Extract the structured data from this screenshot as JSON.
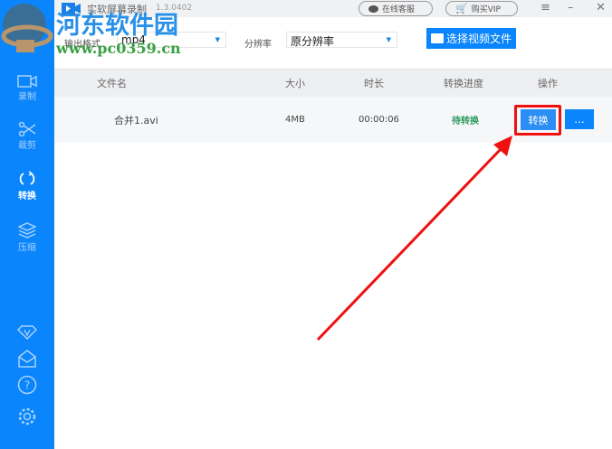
{
  "app": {
    "title": "实软屏幕录制",
    "version": "1.3.0402"
  },
  "header": {
    "online_service": "在线客服",
    "buy_vip": "购买VIP",
    "menu_icon": "menu-icon",
    "minimize_icon": "minimize-icon",
    "close_icon": "close-icon"
  },
  "sidebar": {
    "items": [
      {
        "label": "录制",
        "icon": "video-camera-icon"
      },
      {
        "label": "裁剪",
        "icon": "scissors-icon"
      },
      {
        "label": "转换",
        "icon": "convert-icon",
        "active": true
      },
      {
        "label": "压缩",
        "icon": "layers-icon"
      }
    ],
    "bottom_icons": [
      "vip-diamond-icon",
      "mail-icon",
      "help-icon",
      "settings-icon"
    ]
  },
  "toolbar": {
    "format_label": "输出格式",
    "format_value": "mp4",
    "resolution_label": "分辨率",
    "resolution_value": "原分辨率",
    "choose_file": "选择视频文件"
  },
  "table": {
    "headers": [
      "文件名",
      "大小",
      "时长",
      "转换进度",
      "操作"
    ],
    "rows": [
      {
        "name": "合并1.avi",
        "size": "4MB",
        "duration": "00:00:06",
        "status": "待转换",
        "convert": "转换",
        "more": "..."
      }
    ]
  },
  "watermark": {
    "site_name": "河东软件园",
    "url": "www.pc0359.cn"
  },
  "colors": {
    "accent": "#0a85fb",
    "status_green": "#2e9a5e",
    "highlight_red": "#f01010"
  }
}
